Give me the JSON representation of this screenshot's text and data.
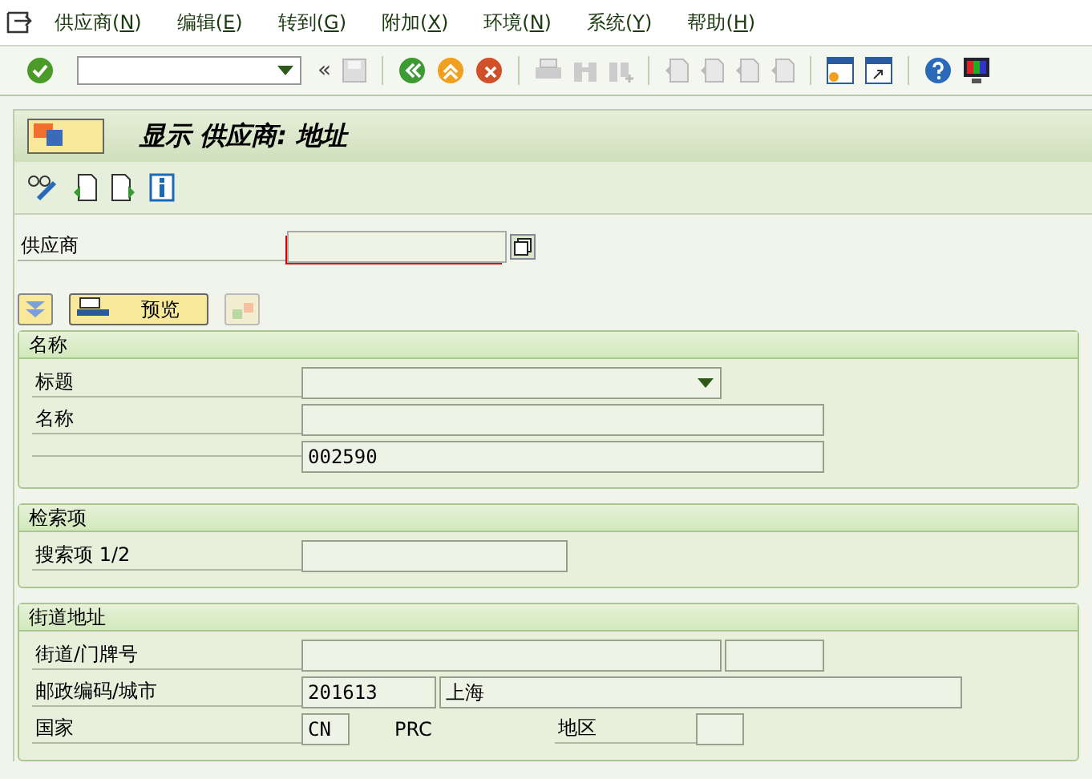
{
  "menu": [
    {
      "before": "供应商(",
      "key": "N",
      "after": ")"
    },
    {
      "before": "编辑(",
      "key": "E",
      "after": ")"
    },
    {
      "before": "转到(",
      "key": "G",
      "after": ")"
    },
    {
      "before": "附加(",
      "key": "X",
      "after": ")"
    },
    {
      "before": "环境(",
      "key": "N",
      "after": ")"
    },
    {
      "before": "系统(",
      "key": "Y",
      "after": ")"
    },
    {
      "before": "帮助(",
      "key": "H",
      "after": ")"
    }
  ],
  "toolbar": {
    "back_mark": "«"
  },
  "title": "显示 供应商: 地址",
  "supplier": {
    "label": "供应商"
  },
  "preview_button": "预览",
  "groups": [
    {
      "title": "名称",
      "rows": [
        {
          "kind": "dropdown",
          "label": "标题"
        },
        {
          "kind": "field",
          "label": "名称"
        },
        {
          "kind": "field",
          "label": "",
          "value": "002590"
        }
      ]
    },
    {
      "title": "检索项",
      "rows": [
        {
          "kind": "short",
          "label": "搜索项 1/2"
        }
      ]
    },
    {
      "title": "街道地址",
      "rows": [
        {
          "kind": "street",
          "label": "街道/门牌号"
        },
        {
          "kind": "city",
          "label": "邮政编码/城市",
          "postcode": "201613",
          "city": "上海"
        },
        {
          "kind": "country",
          "label": "国家",
          "code": "CN",
          "name": "PRC",
          "region_label": "地区"
        }
      ]
    }
  ]
}
